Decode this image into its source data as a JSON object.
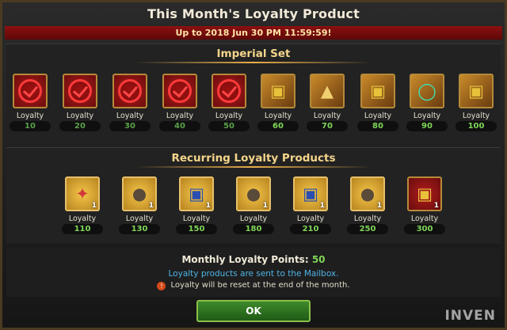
{
  "dialog": {
    "title": "This Month's Loyalty Product",
    "deadline": "Up to 2018 Jun 30 PM 11:59:59!"
  },
  "imperial_set": {
    "heading": "Imperial Set",
    "items": [
      {
        "label": "Loyalty",
        "points": "10",
        "claimed": true,
        "icon": "claimed-check-icon"
      },
      {
        "label": "Loyalty",
        "points": "20",
        "claimed": true,
        "icon": "claimed-check-icon"
      },
      {
        "label": "Loyalty",
        "points": "30",
        "claimed": true,
        "icon": "claimed-check-icon"
      },
      {
        "label": "Loyalty",
        "points": "40",
        "claimed": true,
        "icon": "claimed-check-icon"
      },
      {
        "label": "Loyalty",
        "points": "50",
        "claimed": true,
        "icon": "claimed-check-icon"
      },
      {
        "label": "Loyalty",
        "points": "60",
        "claimed": false,
        "icon": "treasure-chest-icon"
      },
      {
        "label": "Loyalty",
        "points": "70",
        "claimed": false,
        "icon": "armor-boots-icon"
      },
      {
        "label": "Loyalty",
        "points": "80",
        "claimed": false,
        "icon": "treasure-chest-icon"
      },
      {
        "label": "Loyalty",
        "points": "90",
        "claimed": false,
        "icon": "ring-icon"
      },
      {
        "label": "Loyalty",
        "points": "100",
        "claimed": false,
        "icon": "treasure-chest-icon"
      }
    ]
  },
  "recurring": {
    "heading": "Recurring Loyalty Products",
    "items": [
      {
        "label": "Loyalty",
        "points": "110",
        "qty": "1",
        "icon": "winged-emblem-icon"
      },
      {
        "label": "Loyalty",
        "points": "130",
        "qty": "1",
        "icon": "money-bag-icon"
      },
      {
        "label": "Loyalty",
        "points": "150",
        "qty": "1",
        "icon": "treasure-chest-icon"
      },
      {
        "label": "Loyalty",
        "points": "180",
        "qty": "1",
        "icon": "money-bag-icon"
      },
      {
        "label": "Loyalty",
        "points": "210",
        "qty": "1",
        "icon": "treasure-chest-icon"
      },
      {
        "label": "Loyalty",
        "points": "250",
        "qty": "1",
        "icon": "money-bag-icon"
      },
      {
        "label": "Loyalty",
        "points": "300",
        "qty": "1",
        "icon": "treasure-chest-icon"
      }
    ]
  },
  "footer": {
    "monthly_label": "Monthly Loyalty Points:",
    "monthly_value": "50",
    "mail_note": "Loyalty products are sent to the Mailbox.",
    "reset_note": "Loyalty will be reset at the end of the month.",
    "ok_label": "OK"
  },
  "watermark": "INVEN",
  "colors": {
    "points_green": "#7fd657",
    "deadline_red": "#8c1010",
    "heading_gold": "#f4d58a",
    "mail_blue": "#4fb4e6",
    "ok_green": "#3e8a2a"
  }
}
